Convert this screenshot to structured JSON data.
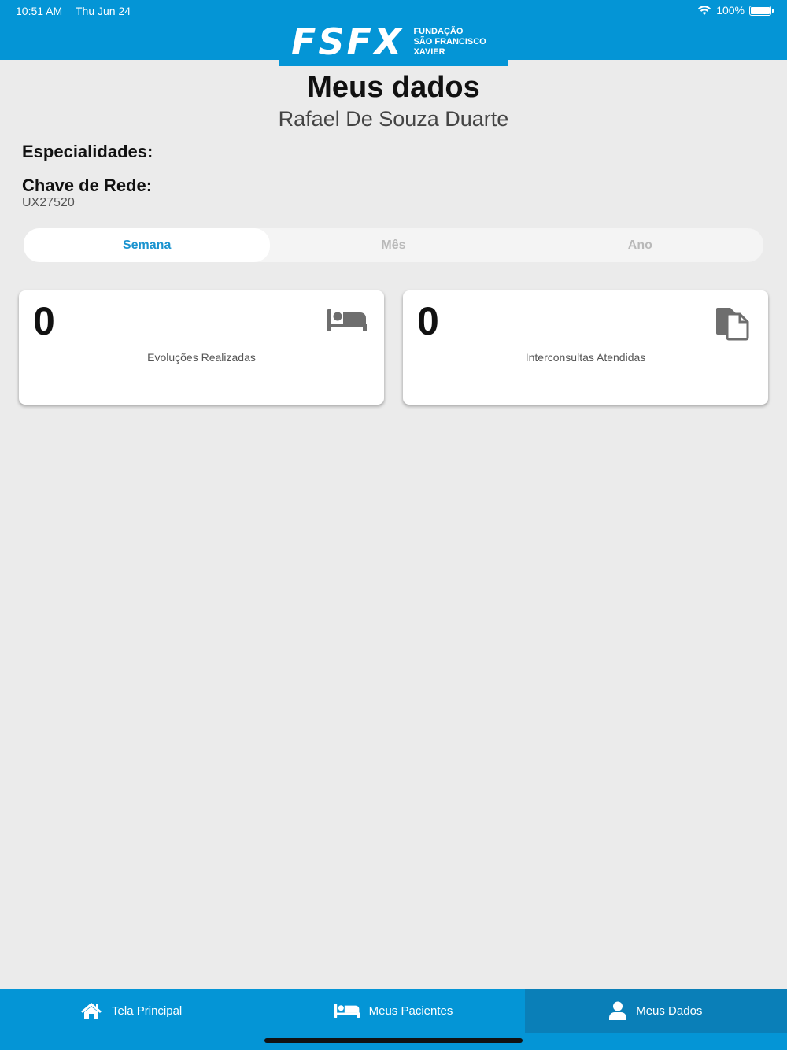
{
  "status_bar": {
    "time": "10:51 AM",
    "date": "Thu Jun 24",
    "battery": "100%"
  },
  "logo": {
    "letters": "FSFX",
    "line1": "FUNDAÇÃO",
    "line2": "SÃO FRANCISCO",
    "line3": "XAVIER"
  },
  "page": {
    "title": "Meus dados",
    "user_name": "Rafael De Souza Duarte"
  },
  "profile": {
    "specialties_label": "Especialidades:",
    "network_key_label": "Chave de Rede:",
    "network_key_value": "UX27520"
  },
  "period_tabs": [
    {
      "label": "Semana",
      "active": true
    },
    {
      "label": "Mês",
      "active": false
    },
    {
      "label": "Ano",
      "active": false
    }
  ],
  "cards": [
    {
      "count": "0",
      "label": "Evoluções Realizadas",
      "icon": "bed-icon"
    },
    {
      "count": "0",
      "label": "Interconsultas Atendidas",
      "icon": "documents-icon"
    }
  ],
  "bottom_nav": [
    {
      "label": "Tela Principal",
      "icon": "home-icon",
      "active": false
    },
    {
      "label": "Meus Pacientes",
      "icon": "bed-icon",
      "active": false
    },
    {
      "label": "Meus Dados",
      "icon": "person-icon",
      "active": true
    }
  ],
  "colors": {
    "primary": "#0495d6",
    "active_tab_text": "#1a93cf",
    "background": "#ebebeb"
  }
}
